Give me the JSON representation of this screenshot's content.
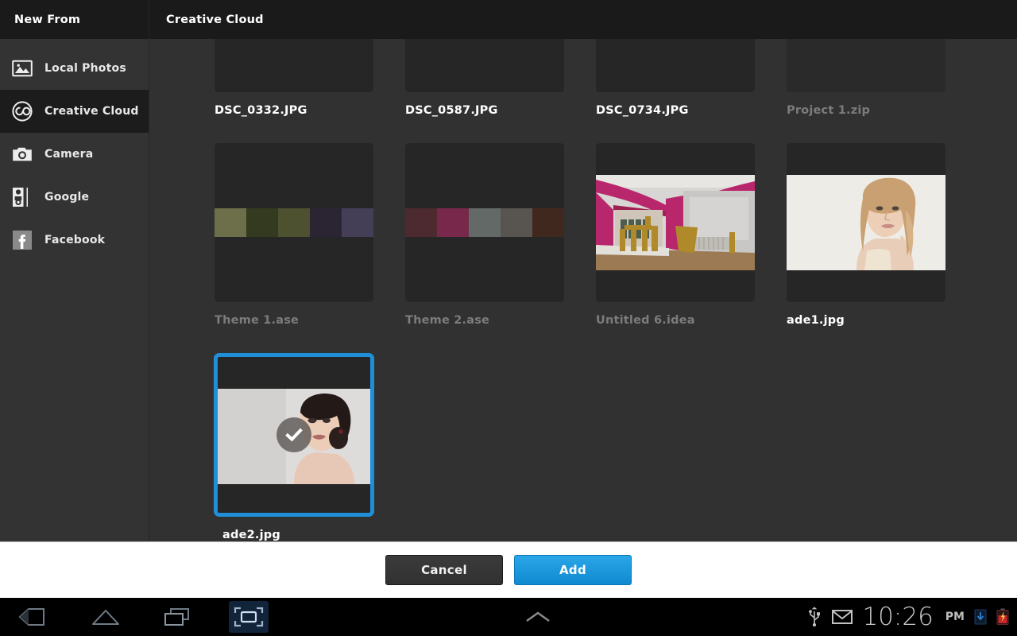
{
  "sidebar": {
    "title": "New From",
    "items": [
      {
        "label": "Local Photos",
        "icon": "photo-icon",
        "selected": false
      },
      {
        "label": "Creative Cloud",
        "icon": "creative-cloud-icon",
        "selected": true
      },
      {
        "label": "Camera",
        "icon": "camera-icon",
        "selected": false
      },
      {
        "label": "Google",
        "icon": "google-plus-icon",
        "selected": false
      },
      {
        "label": "Facebook",
        "icon": "facebook-icon",
        "selected": false
      }
    ]
  },
  "content": {
    "title": "Creative Cloud",
    "items": [
      {
        "name": "DSC_0332.JPG",
        "kind": "photo-strip",
        "enabled": true,
        "selected": false,
        "tint": "#c9a077"
      },
      {
        "name": "DSC_0587.JPG",
        "kind": "photo-strip",
        "enabled": true,
        "selected": false,
        "tint": "#2f6fbe"
      },
      {
        "name": "DSC_0734.JPG",
        "kind": "photo-strip",
        "enabled": true,
        "selected": false,
        "tint": "#1b6fd6"
      },
      {
        "name": "Project 1.zip",
        "kind": "blank",
        "enabled": false,
        "selected": false
      },
      {
        "name": "Theme 1.ase",
        "kind": "swatches",
        "enabled": false,
        "selected": false,
        "swatches": [
          "#6d6f4b",
          "#343a1f",
          "#4d5130",
          "#2b2533",
          "#453e57"
        ]
      },
      {
        "name": "Theme 2.ase",
        "kind": "swatches",
        "enabled": false,
        "selected": false,
        "swatches": [
          "#4c2a2f",
          "#78284a",
          "#636966",
          "#585550",
          "#41281f"
        ]
      },
      {
        "name": "Untitled 6.idea",
        "kind": "room",
        "enabled": false,
        "selected": false
      },
      {
        "name": "ade1.jpg",
        "kind": "portrait-1",
        "enabled": true,
        "selected": false
      },
      {
        "name": "ade2.jpg",
        "kind": "portrait-2",
        "enabled": true,
        "selected": true
      }
    ]
  },
  "footer": {
    "cancel_label": "Cancel",
    "add_label": "Add"
  },
  "system_bar": {
    "nav": [
      {
        "name": "back-icon",
        "active": false
      },
      {
        "name": "home-icon",
        "active": false
      },
      {
        "name": "recents-icon",
        "active": false
      },
      {
        "name": "screenshot-icon",
        "active": true
      }
    ],
    "notification_handle": "chevron-up-icon",
    "status_icons": [
      "usb-icon",
      "gmail-icon",
      "download-icon",
      "battery-icon"
    ],
    "time": "10:26",
    "meridiem": "PM"
  },
  "colors": {
    "accent": "#1f8fd8",
    "panel_bg": "#313131",
    "header_bg": "#1a1a1a",
    "sidebar_bg": "#333333",
    "sidebar_selected_bg": "#1c1c1c",
    "thumb_bg": "#262626",
    "footer_bg": "#ffffff",
    "disabled_text": "#7c7c7c"
  }
}
